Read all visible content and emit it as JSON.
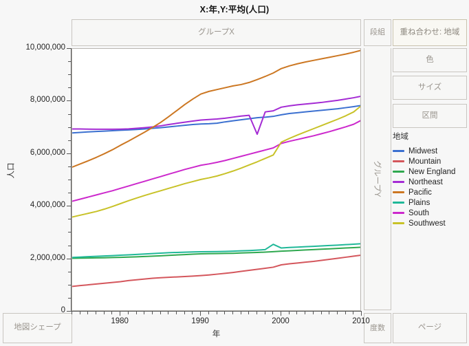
{
  "title": "X:年,Y:平均(人口)",
  "zones": {
    "group_x": "グループX",
    "group_y": "グループY",
    "dangumi": "段組",
    "overlay": "重ね合わせ: 地域",
    "color": "色",
    "size": "サイズ",
    "interval": "区間",
    "map_shape": "地図シェープ",
    "frequency": "度数",
    "page": "ページ"
  },
  "legend": {
    "title": "地域",
    "entries": [
      {
        "label": "Midwest",
        "color": "#3b70d0"
      },
      {
        "label": "Mountain",
        "color": "#d4565c"
      },
      {
        "label": "New England",
        "color": "#2fa84f"
      },
      {
        "label": "Northeast",
        "color": "#a42bd4"
      },
      {
        "label": "Pacific",
        "color": "#cc7722"
      },
      {
        "label": "Plains",
        "color": "#1fb898"
      },
      {
        "label": "South",
        "color": "#cc28cc"
      },
      {
        "label": "Southwest",
        "color": "#c8c228"
      }
    ]
  },
  "chart_data": {
    "type": "line",
    "title": "X:年,Y:平均(人口)",
    "xlabel": "年",
    "ylabel": "人口",
    "xlim": [
      1974,
      2010
    ],
    "ylim": [
      0,
      10000000
    ],
    "grid": false,
    "legend_position": "right",
    "legend_title": "地域",
    "x_ticks": [
      1980,
      1990,
      2000,
      2010
    ],
    "x_tick_labels": [
      "1980",
      "1990",
      "2000",
      "2010"
    ],
    "y_ticks": [
      0,
      2000000,
      4000000,
      6000000,
      8000000,
      10000000
    ],
    "y_tick_labels": [
      "0",
      "2,000,000",
      "4,000,000",
      "6,000,000",
      "8,000,000",
      "10,000,000"
    ],
    "x": [
      1974,
      1975,
      1976,
      1977,
      1978,
      1979,
      1980,
      1981,
      1982,
      1983,
      1984,
      1985,
      1986,
      1987,
      1988,
      1989,
      1990,
      1991,
      1992,
      1993,
      1994,
      1995,
      1996,
      1997,
      1998,
      1999,
      2000,
      2001,
      2002,
      2003,
      2004,
      2005,
      2006,
      2007,
      2008,
      2009,
      2010
    ],
    "series": [
      {
        "name": "Midwest",
        "color": "#3b70d0",
        "values": [
          6800000,
          6820000,
          6840000,
          6855000,
          6870000,
          6885000,
          6900000,
          6915000,
          6930000,
          6950000,
          6975000,
          7000000,
          7030000,
          7060000,
          7090000,
          7120000,
          7140000,
          7150000,
          7170000,
          7220000,
          7260000,
          7300000,
          7340000,
          7380000,
          7400000,
          7430000,
          7490000,
          7540000,
          7570000,
          7600000,
          7630000,
          7660000,
          7690000,
          7720000,
          7760000,
          7800000,
          7850000
        ]
      },
      {
        "name": "Mountain",
        "color": "#d4565c",
        "values": [
          960000,
          990000,
          1020000,
          1050000,
          1080000,
          1110000,
          1140000,
          1180000,
          1210000,
          1240000,
          1270000,
          1290000,
          1305000,
          1320000,
          1335000,
          1350000,
          1370000,
          1395000,
          1425000,
          1455000,
          1490000,
          1530000,
          1570000,
          1610000,
          1650000,
          1690000,
          1780000,
          1820000,
          1850000,
          1880000,
          1910000,
          1950000,
          1990000,
          2030000,
          2070000,
          2110000,
          2150000
        ]
      },
      {
        "name": "New England",
        "color": "#2fa84f",
        "values": [
          2030000,
          2035000,
          2040000,
          2045000,
          2050000,
          2058000,
          2065000,
          2075000,
          2085000,
          2098000,
          2110000,
          2125000,
          2140000,
          2155000,
          2170000,
          2185000,
          2200000,
          2205000,
          2210000,
          2215000,
          2220000,
          2230000,
          2240000,
          2250000,
          2265000,
          2280000,
          2300000,
          2315000,
          2330000,
          2345000,
          2360000,
          2375000,
          2390000,
          2405000,
          2420000,
          2435000,
          2450000
        ]
      },
      {
        "name": "Northeast",
        "color": "#a42bd4",
        "values": [
          6950000,
          6950000,
          6945000,
          6940000,
          6940000,
          6940000,
          6945000,
          6955000,
          6975000,
          7000000,
          7030000,
          7070000,
          7120000,
          7165000,
          7210000,
          7250000,
          7290000,
          7310000,
          7330000,
          7360000,
          7400000,
          7440000,
          7470000,
          6750000,
          7600000,
          7640000,
          7780000,
          7830000,
          7870000,
          7900000,
          7930000,
          7960000,
          8000000,
          8040000,
          8090000,
          8140000,
          8200000
        ]
      },
      {
        "name": "Pacific",
        "color": "#cc7722",
        "values": [
          5500000,
          5620000,
          5740000,
          5870000,
          6010000,
          6160000,
          6330000,
          6490000,
          6660000,
          6830000,
          7010000,
          7200000,
          7420000,
          7650000,
          7880000,
          8090000,
          8280000,
          8380000,
          8450000,
          8520000,
          8590000,
          8640000,
          8720000,
          8830000,
          8950000,
          9080000,
          9250000,
          9350000,
          9430000,
          9500000,
          9560000,
          9620000,
          9680000,
          9740000,
          9800000,
          9870000,
          9950000
        ]
      },
      {
        "name": "Plains",
        "color": "#1fb898",
        "values": [
          2060000,
          2075000,
          2090000,
          2105000,
          2118000,
          2130000,
          2145000,
          2160000,
          2175000,
          2192000,
          2208000,
          2225000,
          2240000,
          2252000,
          2262000,
          2270000,
          2278000,
          2280000,
          2285000,
          2292000,
          2300000,
          2312000,
          2325000,
          2340000,
          2360000,
          2560000,
          2420000,
          2440000,
          2455000,
          2470000,
          2485000,
          2500000,
          2515000,
          2530000,
          2548000,
          2565000,
          2585000
        ]
      },
      {
        "name": "South",
        "color": "#cc28cc",
        "values": [
          4200000,
          4280000,
          4360000,
          4440000,
          4520000,
          4600000,
          4690000,
          4780000,
          4870000,
          4960000,
          5050000,
          5140000,
          5230000,
          5320000,
          5410000,
          5490000,
          5570000,
          5620000,
          5680000,
          5750000,
          5830000,
          5910000,
          5990000,
          6070000,
          6150000,
          6230000,
          6400000,
          6480000,
          6550000,
          6620000,
          6690000,
          6770000,
          6850000,
          6940000,
          7030000,
          7130000,
          7290000
        ]
      },
      {
        "name": "Southwest",
        "color": "#c8c228",
        "values": [
          3600000,
          3670000,
          3740000,
          3810000,
          3900000,
          4000000,
          4110000,
          4220000,
          4320000,
          4420000,
          4510000,
          4600000,
          4690000,
          4780000,
          4870000,
          4950000,
          5030000,
          5090000,
          5160000,
          5250000,
          5350000,
          5460000,
          5580000,
          5700000,
          5830000,
          5960000,
          6450000,
          6590000,
          6720000,
          6840000,
          6960000,
          7080000,
          7200000,
          7320000,
          7450000,
          7600000,
          7850000
        ]
      }
    ]
  }
}
